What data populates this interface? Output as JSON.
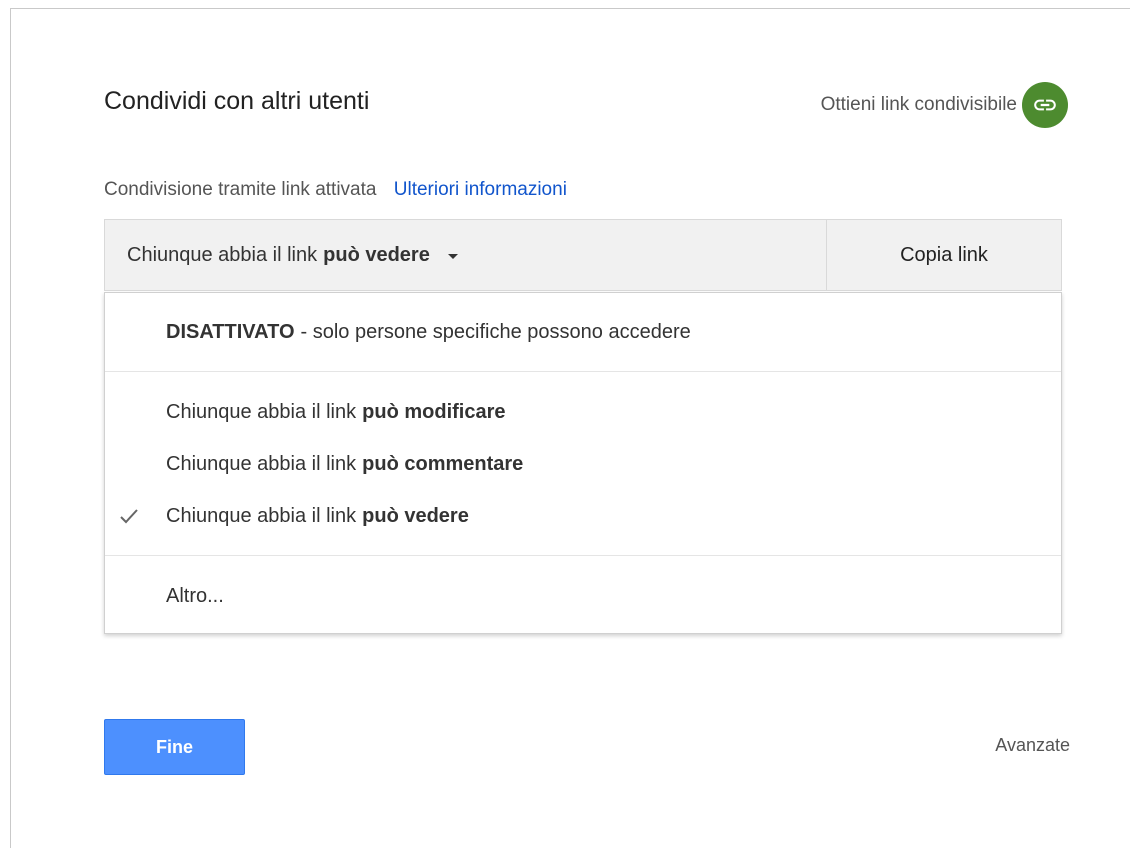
{
  "dialog": {
    "title": "Condividi con altri utenti",
    "shareable_link_label": "Ottieni link condivisibile",
    "status_text": "Condivisione tramite link attivata",
    "more_info_link": "Ulteriori informazioni",
    "access_selector": {
      "prefix": "Chiunque abbia il link",
      "permission": "può vedere"
    },
    "copy_link_label": "Copia link",
    "menu": {
      "off_option": {
        "keyword": "DISATTIVATO",
        "description": "- solo persone specifiche possono accedere"
      },
      "options": [
        {
          "prefix": "Chiunque abbia il link",
          "permission": "può modificare",
          "selected": false
        },
        {
          "prefix": "Chiunque abbia il link",
          "permission": "può commentare",
          "selected": false
        },
        {
          "prefix": "Chiunque abbia il link",
          "permission": "può vedere",
          "selected": true
        }
      ],
      "more_option": "Altro..."
    },
    "done_button": "Fine",
    "advanced_link": "Avanzate",
    "colors": {
      "link_icon_bg": "#4d8b2f",
      "primary_button": "#4d90fe",
      "link_text": "#1155cc"
    }
  }
}
